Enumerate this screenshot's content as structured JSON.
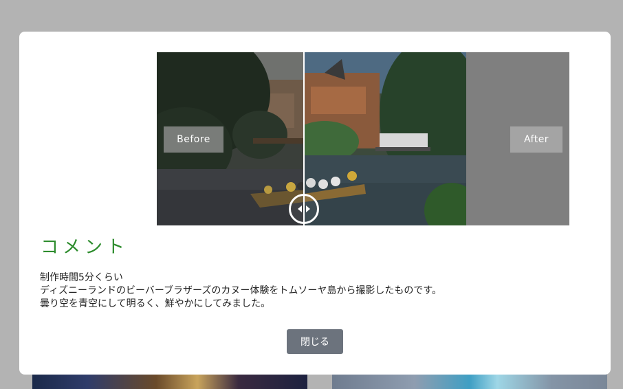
{
  "comparison": {
    "before_label": "Before",
    "after_label": "After"
  },
  "comment": {
    "heading": "コメント",
    "lines": [
      "制作時間5分くらい",
      "ディズニーランドのビーバーブラザーズのカヌー体験をトムソーヤ島から撮影したものです。",
      "曇り空を青空にして明るく、鮮やかにしてみました。"
    ]
  },
  "actions": {
    "close_label": "閉じる"
  }
}
